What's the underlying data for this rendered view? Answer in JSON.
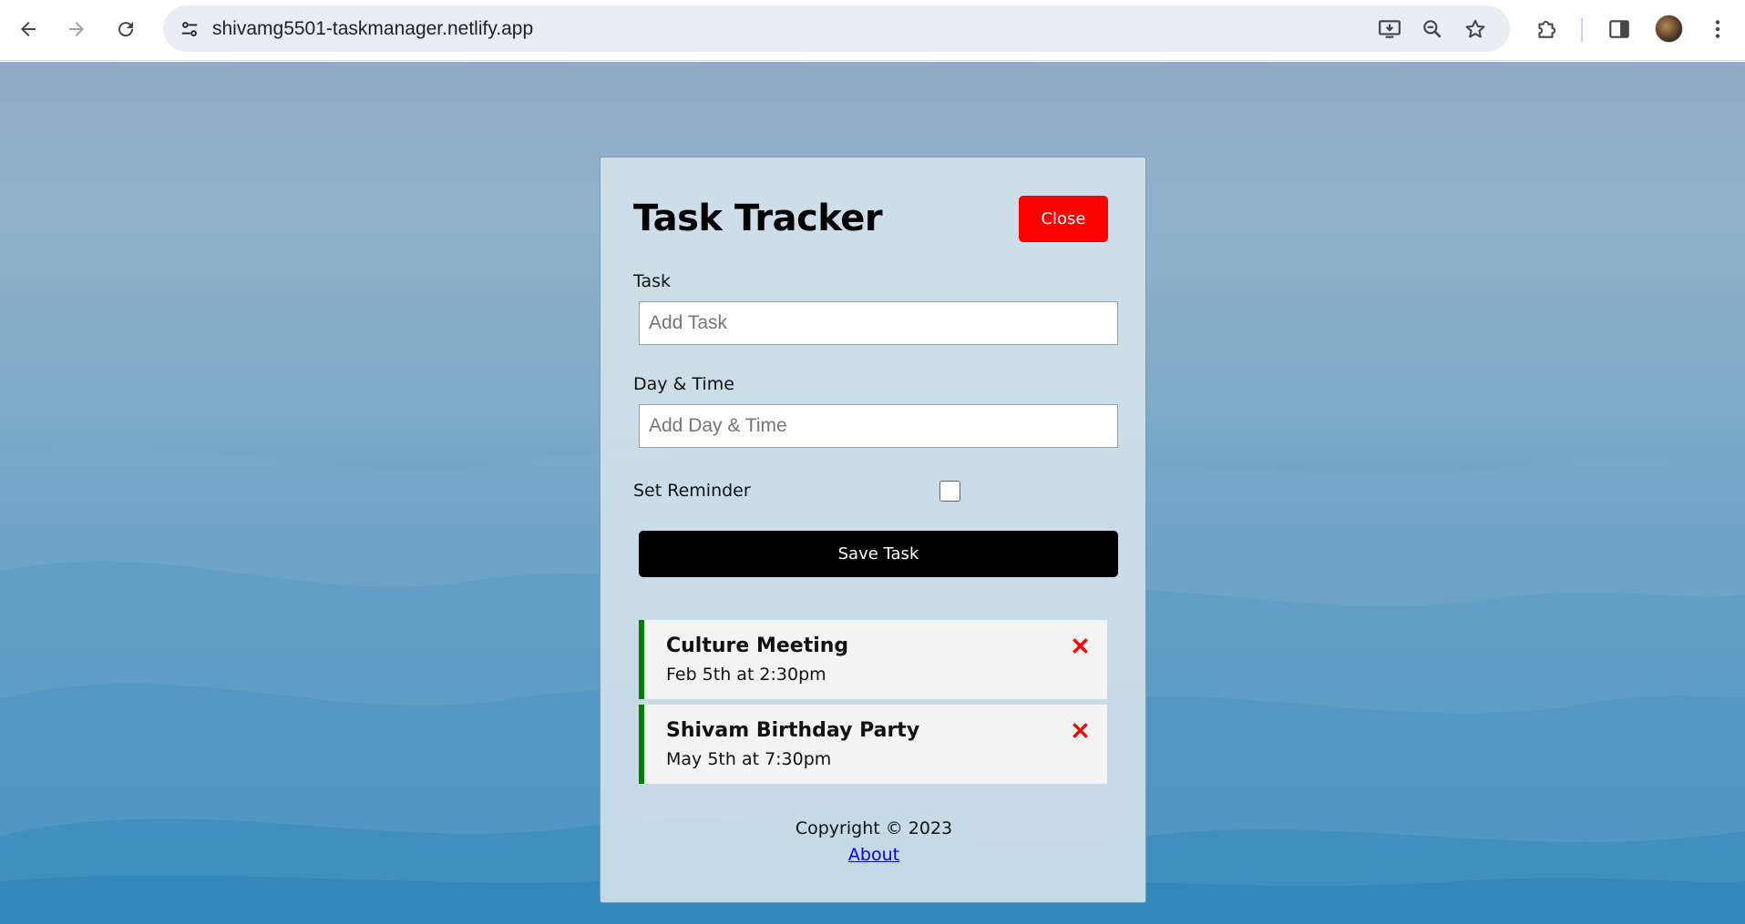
{
  "browser": {
    "url": "shivamg5501-taskmanager.netlify.app",
    "icons": {
      "back": "back-arrow-icon",
      "forward": "forward-arrow-icon",
      "reload": "reload-icon",
      "site_info": "tune-icon",
      "install": "install-app-icon",
      "zoom": "zoom-icon",
      "bookmark": "star-icon",
      "extensions": "puzzle-icon",
      "side_panel": "side-panel-icon",
      "menu": "kebab-menu-icon"
    }
  },
  "app": {
    "title": "Task Tracker",
    "close_button": "Close",
    "close_color": "#ff0000",
    "form": {
      "task_label": "Task",
      "task_placeholder": "Add Task",
      "day_label": "Day & Time",
      "day_placeholder": "Add Day & Time",
      "reminder_label": "Set Reminder",
      "reminder_checked": false,
      "save_button": "Save Task"
    },
    "tasks": [
      {
        "text": "Culture Meeting",
        "day": "Feb 5th at 2:30pm",
        "reminder": true
      },
      {
        "text": "Shivam Birthday Party",
        "day": "May 5th at 7:30pm",
        "reminder": true
      }
    ],
    "reminder_color": "#008000",
    "delete_color": "#ff0000",
    "footer": {
      "copyright": "Copyright © 2023",
      "about_link": "About"
    }
  }
}
